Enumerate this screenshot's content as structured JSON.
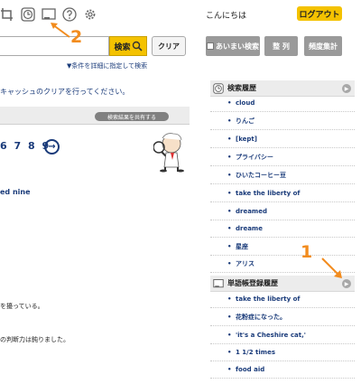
{
  "header": {
    "greeting": "こんにちは",
    "logout_label": "ログアウト",
    "icons": [
      "crop-icon",
      "clock-icon",
      "wordbook-icon",
      "help-icon",
      "gear-icon"
    ]
  },
  "search": {
    "value": "",
    "button_label": "検索",
    "clear_label": "クリア",
    "detail_link": "▼条件を詳細に指定して検索"
  },
  "toolbar": {
    "fuzzy_label": "あいまい検索",
    "sort_label": "整 列",
    "freq_label": "頻度集計"
  },
  "main": {
    "notice": "キャッシュのクリアを行ってください。",
    "share_label": "検索結果を共有する",
    "pages": "6 7 8 9",
    "result_link": "ed nine",
    "text1": "を擾っている。",
    "text2": "の判断力は鈍りました。"
  },
  "history": {
    "title": "検索履歴",
    "items": [
      "cloud",
      "りんご",
      "[kept]",
      "プライバシー",
      "ひいたコーヒー豆",
      "take the liberty of",
      "dreamed",
      "dreame",
      "星座",
      "アリス"
    ]
  },
  "wordbook": {
    "title": "単語帳登録履歴",
    "items": [
      "take the liberty of",
      "花粉症になった。",
      "'it's a Cheshire cat,'",
      "1 1/2 times",
      "food aid"
    ]
  },
  "annotations": {
    "label1": "1",
    "label2": "2"
  },
  "colors": {
    "accent": "#f4c200",
    "link": "#1a3b7a",
    "annotation": "#f28c1e"
  }
}
